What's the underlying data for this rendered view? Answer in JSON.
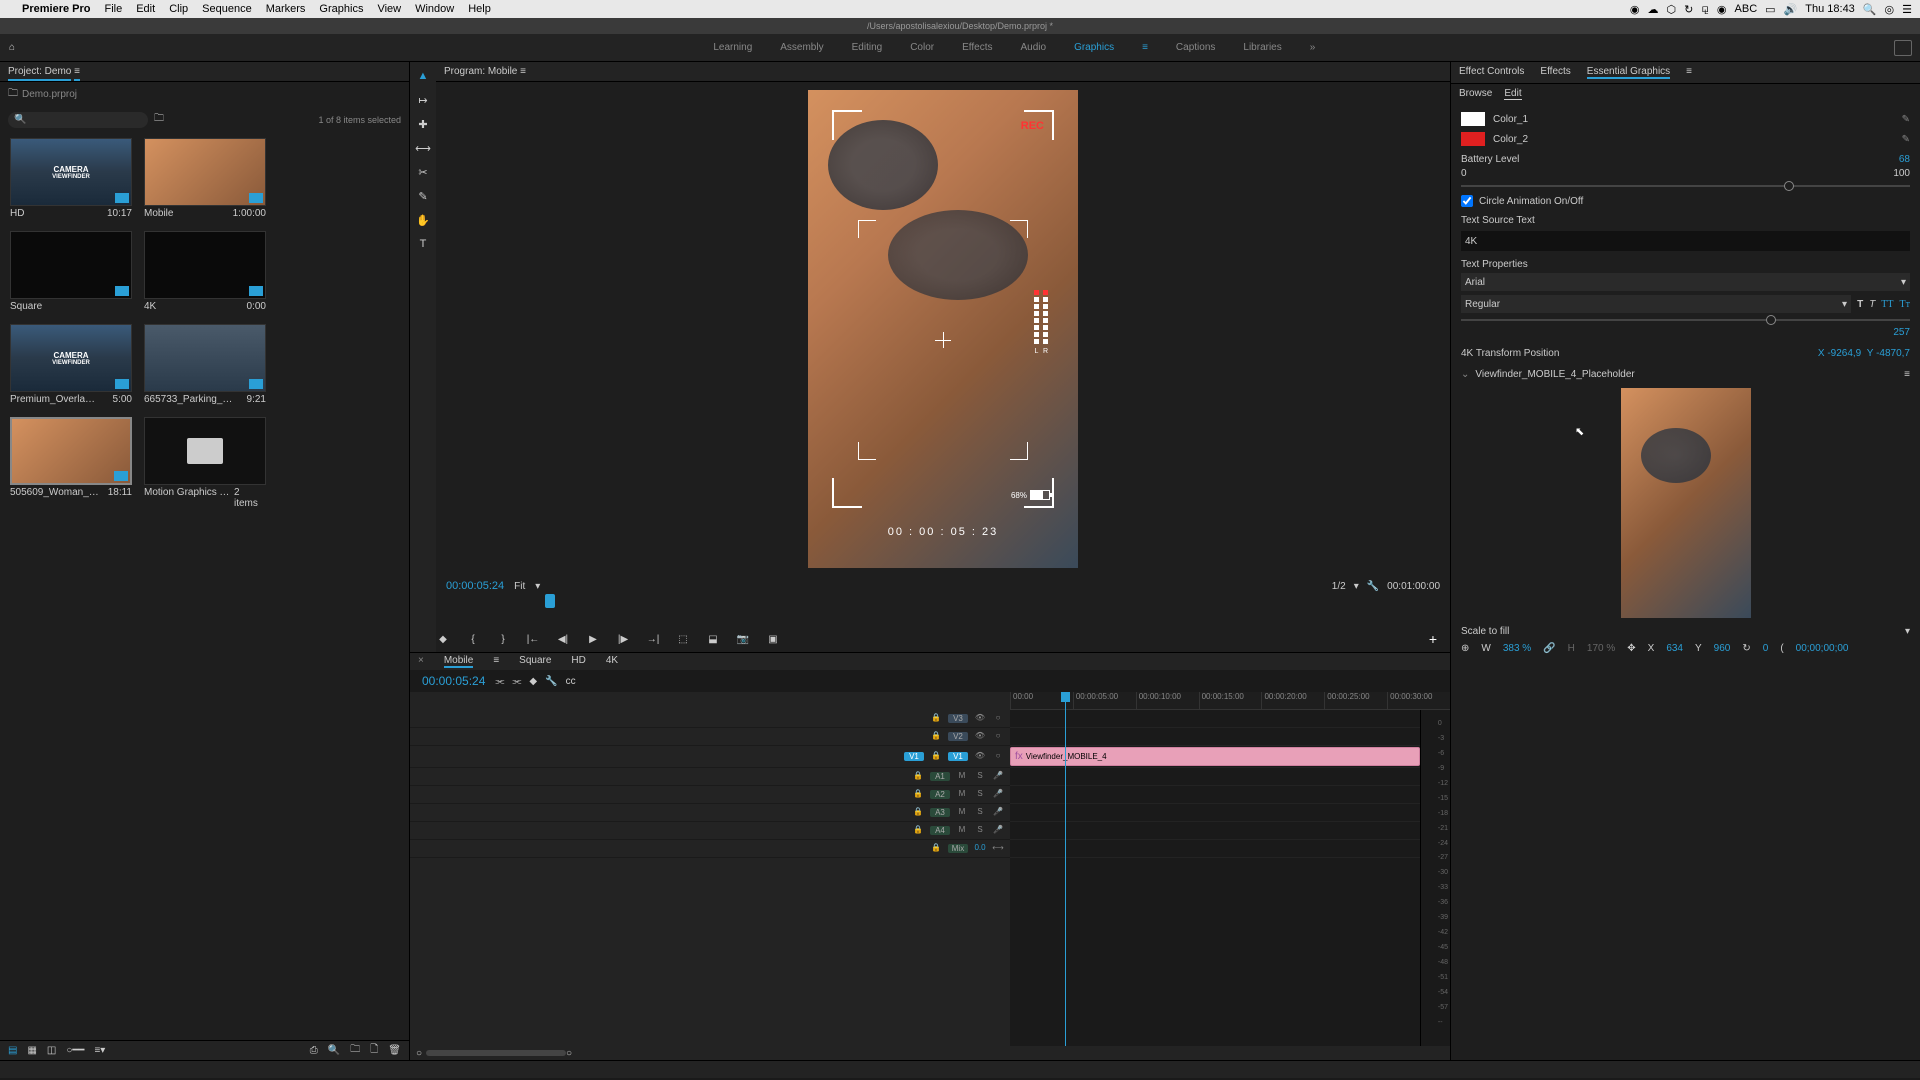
{
  "menubar": {
    "app": "Premiere Pro",
    "items": [
      "File",
      "Edit",
      "Clip",
      "Sequence",
      "Markers",
      "Graphics",
      "View",
      "Window",
      "Help"
    ],
    "right": {
      "abc": "ABC",
      "time": "Thu 18:43"
    }
  },
  "titlebar": "/Users/apostolisalexiou/Desktop/Demo.prproj *",
  "workspaces": [
    "Learning",
    "Assembly",
    "Editing",
    "Color",
    "Effects",
    "Audio",
    "Graphics",
    "Captions",
    "Libraries"
  ],
  "workspace_active": "Graphics",
  "project": {
    "tab": "Project: Demo",
    "file": "Demo.prproj",
    "status": "1 of 8 items selected"
  },
  "bins": [
    {
      "name": "HD",
      "dur": "10:17",
      "type": "cam"
    },
    {
      "name": "Mobile",
      "dur": "1:00:00",
      "type": "face"
    },
    {
      "name": "Square",
      "dur": "",
      "type": "dark"
    },
    {
      "name": "4K",
      "dur": "0:00",
      "type": "dark"
    },
    {
      "name": "Premium_Overlays_Ca...",
      "dur": "5:00",
      "type": "cam"
    },
    {
      "name": "665733_Parking_Lot_Cl...",
      "dur": "9:21",
      "type": "park"
    },
    {
      "name": "505609_Woman_Vacat...",
      "dur": "18:11",
      "type": "face",
      "sel": true
    },
    {
      "name": "Motion Graphics Te...",
      "dur": "2 items",
      "type": "folder"
    }
  ],
  "tools": [
    "▲",
    "↦",
    "✚",
    "⟷",
    "✂",
    "✎",
    "✒",
    "T"
  ],
  "monitor": {
    "tab": "Program: Mobile",
    "rec": "REC",
    "bars_l": "L",
    "bars_r": "R",
    "batt": "68%",
    "tc": "00 : 00 : 05 : 23",
    "playhead_pct": 10
  },
  "controls": {
    "tc": "00:00:05:24",
    "fit": "Fit",
    "res": "1/2",
    "wrench": "🔧",
    "dur": "00:01:00:00"
  },
  "timeline": {
    "tabs": [
      "Mobile",
      "Square",
      "HD",
      "4K"
    ],
    "active": "Mobile",
    "tc": "00:00:05:24",
    "ruler": [
      "00:00",
      "00:00:05:00",
      "00:00:10:00",
      "00:00:15:00",
      "00:00:20:00",
      "00:00:25:00",
      "00:00:30:00"
    ],
    "vtracks": [
      "V3",
      "V2",
      "V1"
    ],
    "atracks": [
      "A1",
      "A2",
      "A3",
      "A4",
      "Mix"
    ],
    "mix_val": "0.0",
    "clip": "Viewfinder_MOBILE_4",
    "playhead_pct": 13.5
  },
  "meter": [
    "0",
    "-3",
    "-6",
    "-9",
    "-12",
    "-15",
    "-18",
    "-21",
    "-24",
    "-27",
    "-30",
    "-33",
    "-36",
    "-39",
    "-42",
    "-45",
    "-48",
    "-51",
    "-54",
    "-57",
    "--"
  ],
  "rp": {
    "tabs": [
      "Effect Controls",
      "Effects",
      "Essential Graphics"
    ],
    "active": "Essential Graphics",
    "sub": [
      "Browse",
      "Edit"
    ],
    "sub_active": "Edit",
    "color1": "Color_1",
    "color2": "Color_2",
    "battery": {
      "label": "Battery Level",
      "min": "0",
      "max": "100",
      "val": "68",
      "pct": 72
    },
    "circle": "Circle Animation On/Off",
    "text_src": {
      "label": "Text Source Text",
      "val": "4K"
    },
    "text_props": {
      "label": "Text Properties",
      "font": "Arial",
      "weight": "Regular",
      "size": "257",
      "size_pct": 68
    },
    "xform": {
      "label": "4K Transform Position",
      "x": "X",
      "xv": "-9264,9",
      "y": "Y",
      "yv": "-4870,7"
    },
    "placeholder": "Viewfinder_MOBILE_4_Placeholder",
    "scale": "Scale to fill",
    "tr": {
      "w": "W",
      "wv": "383 %",
      "h": "H",
      "hv": "170 %",
      "x": "X",
      "xv": "634",
      "y": "Y",
      "yv": "960",
      "rot": "0",
      "time": "00;00;00;00"
    }
  }
}
